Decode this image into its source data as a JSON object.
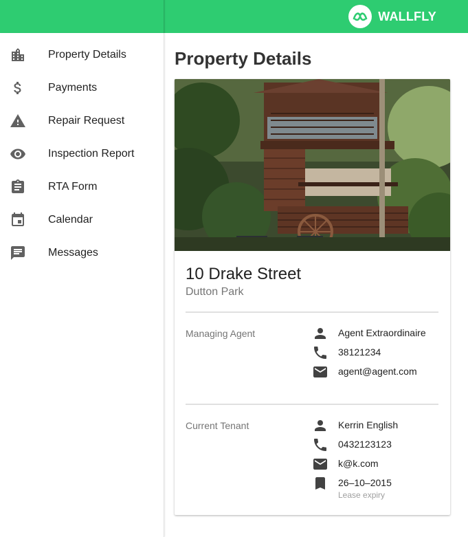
{
  "app": {
    "brand_name": "WALLFLY",
    "accent_color": "#2ecc71"
  },
  "sidebar": {
    "items": [
      {
        "label": "Property Details",
        "icon": "building-icon"
      },
      {
        "label": "Payments",
        "icon": "dollar-icon"
      },
      {
        "label": "Repair Request",
        "icon": "warning-icon"
      },
      {
        "label": "Inspection Report",
        "icon": "eye-icon"
      },
      {
        "label": "RTA Form",
        "icon": "clipboard-icon"
      },
      {
        "label": "Calendar",
        "icon": "calendar-icon"
      },
      {
        "label": "Messages",
        "icon": "message-icon"
      }
    ]
  },
  "main": {
    "page_title": "Property Details",
    "property": {
      "address": "10 Drake Street",
      "suburb": "Dutton Park"
    },
    "managing_agent": {
      "label": "Managing Agent",
      "name": "Agent Extraordinaire",
      "phone": "38121234",
      "email": "agent@agent.com"
    },
    "current_tenant": {
      "label": "Current Tenant",
      "name": "Kerrin English",
      "phone": "0432123123",
      "email": "k@k.com",
      "lease_expiry": "26–10–2015",
      "lease_expiry_label": "Lease expiry"
    }
  }
}
